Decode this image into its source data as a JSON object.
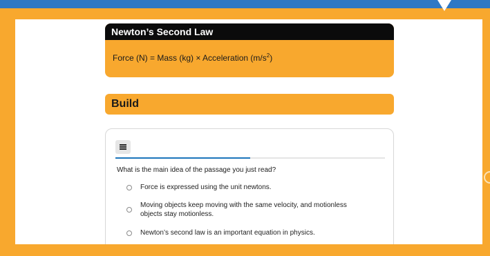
{
  "law_card": {
    "title": "Newton’s Second Law",
    "formula_main": "Force (N) = Mass (kg) × Acceleration (m/s",
    "formula_exponent": "2",
    "formula_close": ")"
  },
  "build_header": {
    "label": "Build"
  },
  "quiz": {
    "progress": 0.5,
    "question": "What is the main idea of the passage you just read?",
    "options": [
      {
        "label": "Force is expressed using the unit newtons."
      },
      {
        "label": "Moving objects keep moving with the same velocity, and motionless objects stay motionless."
      },
      {
        "label": "Newton’s second law is an important equation in physics."
      }
    ]
  },
  "colors": {
    "frame": "#f8a82e",
    "background": "#2f78c4",
    "progress": "#1b75bb",
    "header_dark": "#0b0b0b"
  },
  "icons": {
    "menu": "hamburger-icon"
  }
}
